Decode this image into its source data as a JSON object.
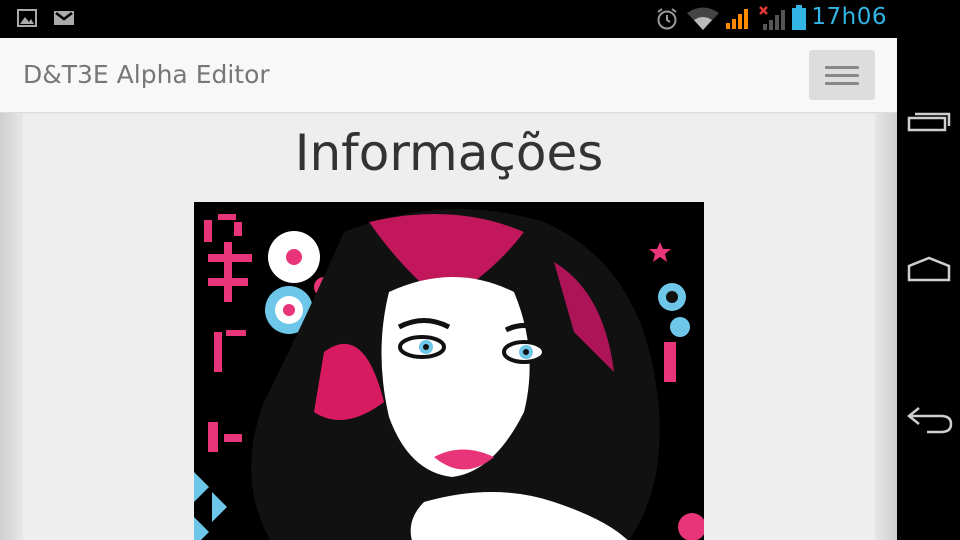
{
  "status_bar": {
    "time": "17h06",
    "time_color": "#33b5e5",
    "notification_icons": [
      "image-icon",
      "gmail-icon"
    ],
    "system_icons": [
      "alarm-icon",
      "wifi-icon",
      "signal-icon",
      "no-signal-icon",
      "battery-icon"
    ]
  },
  "navbar": {
    "brand": "D&T3E Alpha Editor",
    "menu_icon": "hamburger-icon"
  },
  "main": {
    "title": "Informações",
    "image_icon": "artwork-image"
  },
  "system_nav": {
    "buttons": [
      "recent-apps-icon",
      "home-icon",
      "back-icon"
    ]
  }
}
